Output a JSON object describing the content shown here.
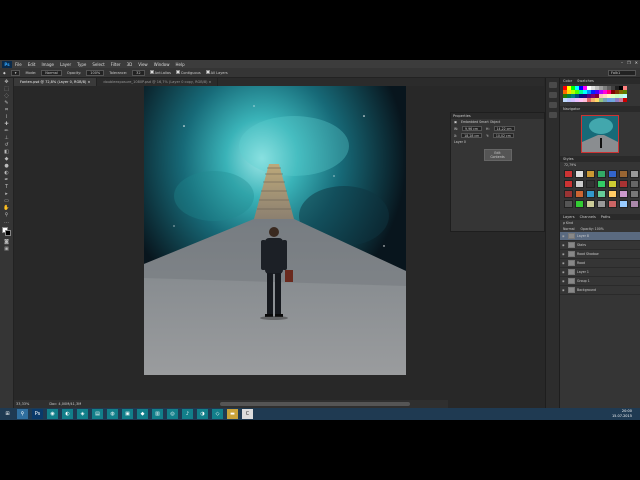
{
  "menubar": {
    "app_logo": "Ps",
    "items": [
      "File",
      "Edit",
      "Image",
      "Layer",
      "Type",
      "Select",
      "Filter",
      "3D",
      "View",
      "Window",
      "Help"
    ],
    "window_controls": [
      "–",
      "❐",
      "✕"
    ]
  },
  "options": {
    "mode_label": "Mode:",
    "mode_value": "Normal",
    "opacity_label": "Opacity:",
    "opacity_value": "100%",
    "tolerance_label": "Tolerance:",
    "tolerance_value": "32",
    "antialias": "Anti-alias",
    "contiguous": "Contiguous",
    "all_layers": "All Layers",
    "search_value": "Folk1"
  },
  "tabs": [
    {
      "label": "Fonten.psd @ 72,8% (Layer 0, RGB/8) ×"
    },
    {
      "label": "doubleexposure_1080P.psd @ 16,7% (Layer 0 copy, RGB/8) ×"
    }
  ],
  "status": {
    "zoom": "33,33%",
    "doc": "Doc: 4,00M/41,3M"
  },
  "properties": {
    "title": "Properties",
    "subtitle": "Embedded Smart Object",
    "w_label": "W:",
    "w_value": "9,96 cm",
    "h_label": "H:",
    "h_value": "14,22 cm",
    "x_label": "X:",
    "x_value": "18,28 cm",
    "y_label": "Y:",
    "y_value": "10,02 cm",
    "layer_label": "Layer 0",
    "button": "Edit Contents"
  },
  "panels": {
    "color_tabs": [
      "Color",
      "Swatches"
    ],
    "navigator_title": "Navigator",
    "styles_title": "Styles",
    "styles_zoom": "72,79%",
    "layers_tabs": [
      "Layers",
      "Channels",
      "Paths"
    ],
    "layers_kind": "ρ Kind",
    "layers_blend": "Normal",
    "layers_opacity": "Opacity: 100%",
    "layers": [
      {
        "name": "Layer 8",
        "selected": true
      },
      {
        "name": "Stairs",
        "selected": false
      },
      {
        "name": "Road Shadow",
        "selected": false
      },
      {
        "name": "Road",
        "selected": false
      },
      {
        "name": "Layer 1",
        "selected": false
      },
      {
        "name": "Group 1",
        "selected": false
      },
      {
        "name": "Background",
        "selected": false
      }
    ]
  },
  "clock": {
    "time": "20:00",
    "date": "15.07.2015"
  },
  "colors": {
    "swatches": [
      "#ff0000",
      "#ffff00",
      "#00ff00",
      "#00ffff",
      "#0000ff",
      "#ff00ff",
      "#ffffff",
      "#e0e0e0",
      "#c0c0c0",
      "#a0a0a0",
      "#808080",
      "#606060",
      "#404040",
      "#202020",
      "#000000",
      "#ff8080",
      "#ff6a00",
      "#ffd800",
      "#b6ff00",
      "#4cff00",
      "#00ff90",
      "#00ffff",
      "#0094ff",
      "#0026ff",
      "#4800ff",
      "#b200ff",
      "#ff00dc",
      "#ff006e",
      "#7f0000",
      "#7f3300",
      "#7f6a00",
      "#5b7f00",
      "#267f00",
      "#007f46",
      "#007f7f",
      "#004a7f",
      "#00137f",
      "#21007f",
      "#57007f",
      "#7f006e",
      "#7f0037",
      "#ffbfbf",
      "#ffd8bf",
      "#fff4bf",
      "#e5ffbf",
      "#c9ffbf",
      "#bfffd8",
      "#bfffff",
      "#bfdcff",
      "#bfc7ff",
      "#d1bfff",
      "#ecbfff",
      "#ffbff4",
      "#ffbfd8",
      "#e06666",
      "#f6b26b",
      "#ffd966",
      "#93c47d",
      "#76a5af",
      "#6d9eeb",
      "#6fa8dc",
      "#8e7cc3",
      "#c27ba0",
      "#cc0000"
    ],
    "styles": [
      "#c33",
      "#ddd",
      "#c93",
      "#3a6",
      "#36c",
      "#963",
      "#999",
      "#c33",
      "#ccc",
      "#333",
      "#3c6",
      "#cc3",
      "#a33",
      "#666",
      "#933",
      "#c63",
      "#39c",
      "#6c9",
      "#fc6",
      "#c9c",
      "#777",
      "#555",
      "#3c3",
      "#cc9",
      "#999",
      "#c66",
      "#9cf",
      "#a8a"
    ]
  }
}
